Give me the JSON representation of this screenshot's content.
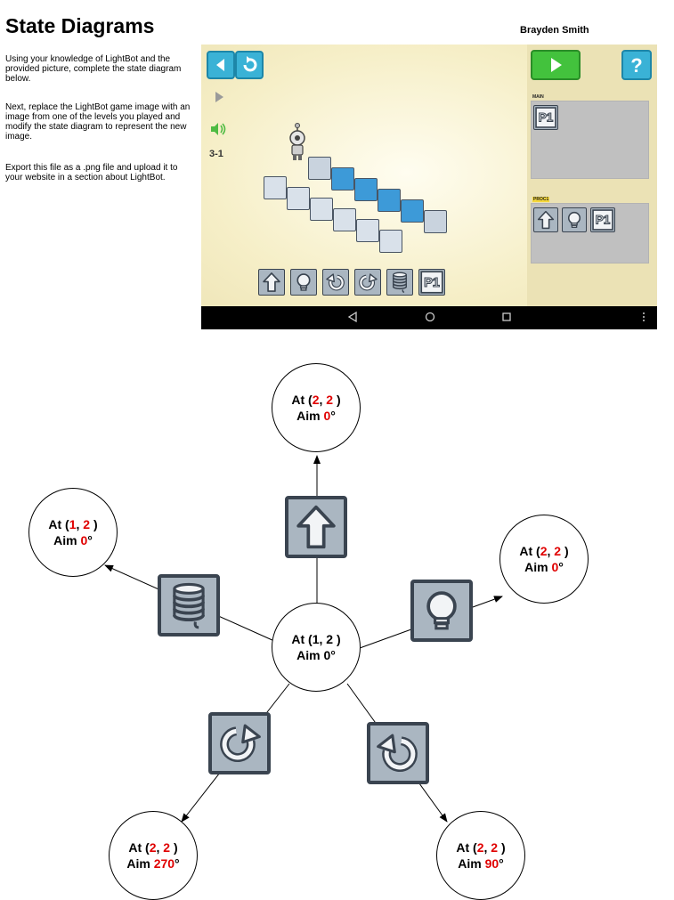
{
  "page": {
    "title": "State Diagrams",
    "author": "Brayden Smith",
    "instructions": [
      "Using your knowledge of LightBot and the provided picture, complete the state diagram below.",
      "Next, replace the LightBot game image with an image from one of the levels you played and modify the state diagram to represent the new image.",
      "Export this file as a .png file and upload it to your website in a section about LightBot."
    ]
  },
  "game": {
    "level": "3-1",
    "main_label": "MAIN",
    "proc_label": "PROC1",
    "main_slots": [
      "P1"
    ],
    "proc_slots": [
      "forward",
      "light",
      "P1"
    ],
    "palette": [
      "forward",
      "light",
      "turn-left",
      "turn-right",
      "jump",
      "P1"
    ],
    "p1_text": "P1"
  },
  "diagram": {
    "center": {
      "at": "At (1, 2 )",
      "aim": "Aim 0°"
    },
    "nodes": [
      {
        "id": "top",
        "x": "2",
        "y": "2",
        "aim": "0",
        "command": "forward"
      },
      {
        "id": "left",
        "x": "1",
        "y": "2",
        "aim": "0",
        "command": "jump"
      },
      {
        "id": "right",
        "x": "2",
        "y": "2",
        "aim": "0",
        "command": "light"
      },
      {
        "id": "bottom-left",
        "x": "2",
        "y": "2",
        "aim": "270",
        "command": "turn-right"
      },
      {
        "id": "bottom-right",
        "x": "2",
        "y": "2",
        "aim": "90",
        "command": "turn-left"
      }
    ],
    "labels": {
      "at": "At (",
      "sep": ", ",
      "close": " )",
      "aim": "Aim ",
      "deg": "°"
    }
  }
}
